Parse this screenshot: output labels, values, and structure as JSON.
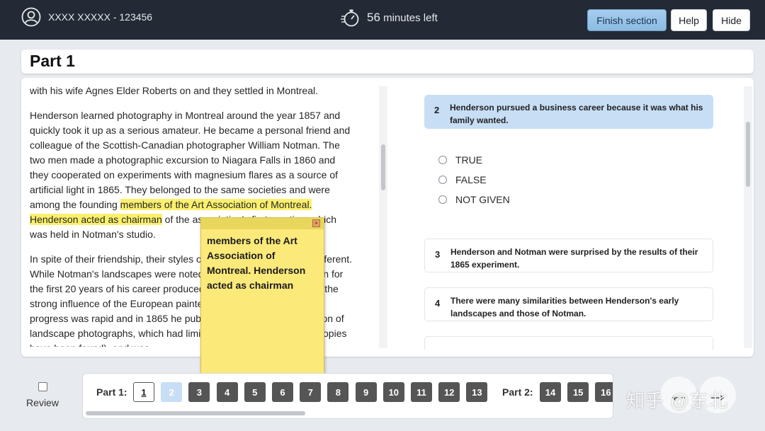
{
  "header": {
    "user_label": "XXXX XXXXX - 123456",
    "timer_value": "56",
    "timer_suffix": " minutes left",
    "finish_label": "Finish section",
    "help_label": "Help",
    "hide_label": "Hide"
  },
  "part": {
    "title": "Part 1"
  },
  "reading": {
    "p1": "with his wife Agnes Elder Roberts on and they settled in Montreal.",
    "p2_before": "Henderson learned photography in Montreal around the year 1857 and quickly took it up as a serious amateur. He became a personal friend and colleague of the Scottish-Canadian photographer William Notman. The two men made a photographic excursion to Niagara Falls in 1860 and they cooperated on experiments with magnesium flares as a source of artificial light in 1865. They belonged to the same societies and were among the founding ",
    "p2_highlight": "members of the Art Association of Montreal. Henderson acted as chairman",
    "p2_after": " of the association's first meeting, which was held in Notman's studio.",
    "p3": "In spite of their friendship, their styles of photography were quite different. While Notman's landscapes were noted for their realism, Henderson for the first 20 years of his career produced romantic images, showing the strong influence of the European painters. His artistic and technical progress was rapid and in 1865 he published his first major collection of landscape photographs, which had limited circulation (only seven copies have been found), and was"
  },
  "questions": {
    "q2": {
      "num": "2",
      "text": "Henderson pursued a business career because it was what his family wanted."
    },
    "options": [
      "TRUE",
      "FALSE",
      "NOT GIVEN"
    ],
    "q3": {
      "num": "3",
      "text": "Henderson and Notman were surprised by the results of their 1865 experiment."
    },
    "q4": {
      "num": "4",
      "text": "There were many similarities between Henderson's early landscapes and those of Notman."
    }
  },
  "note": {
    "close_glyph": "×",
    "text": "members of the Art Association of Montreal. Henderson acted as chairman"
  },
  "nav": {
    "review_label": "Review",
    "part1_label": "Part 1:",
    "part2_label": "Part 2:",
    "part1_questions": [
      "1",
      "2",
      "3",
      "4",
      "5",
      "6",
      "7",
      "8",
      "9",
      "10",
      "11",
      "12",
      "13"
    ],
    "part2_questions": [
      "14",
      "15",
      "16"
    ],
    "current_question": "1",
    "highlighted_question": "2"
  },
  "arrows": {
    "prev": "←",
    "next": "→"
  },
  "watermark": "知乎 @东北",
  "colors": {
    "topbar": "#232a35",
    "accent": "#a6cdee",
    "highlight": "#fbf06d",
    "note": "#fbe97a",
    "active_question": "#c7def5"
  }
}
